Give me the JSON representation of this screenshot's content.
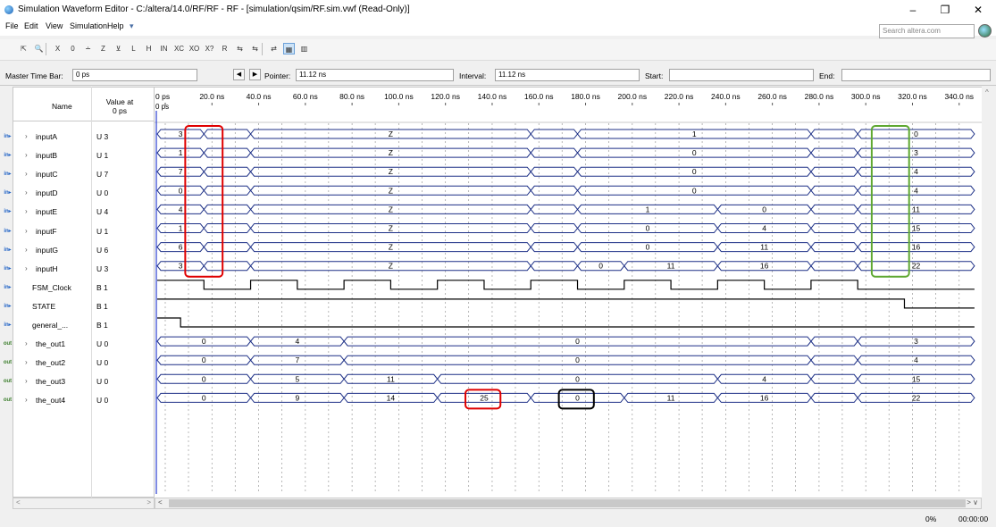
{
  "window": {
    "title": "Simulation Waveform Editor - C:/altera/14.0/RF/RF - RF - [simulation/qsim/RF.sim.vwf (Read-Only)]",
    "minimize": "–",
    "maximize": "❐",
    "close": "✕"
  },
  "menu": [
    "File",
    "Edit",
    "View",
    "Simulation",
    "Help"
  ],
  "search_placeholder": "Search altera.com",
  "toolbar_icons": [
    "pointer-icon",
    "zoom-icon",
    "invert-icon",
    "count-value-icon",
    "forcing-low-icon",
    "forcing-high-icon",
    "high-impedance-icon",
    "weak-low-icon",
    "weak-high-icon",
    "invert-value-icon",
    "count-icon",
    "clock-icon",
    "random-icon",
    "arbitrary-value-icon",
    "snap-icon",
    "merge-icon",
    "ungroup-icon",
    "grid-icon",
    "waveform-icon"
  ],
  "toolbar_glyphs": [
    "⇱",
    "🔍",
    "X",
    "0",
    "∸",
    "Z",
    "⊻",
    "L",
    "H",
    "IN",
    "XC",
    "XO",
    "X?",
    "R",
    "⇆",
    "⇆",
    "⇄",
    "▦",
    "▥"
  ],
  "masterbar": {
    "master_label": "Master Time Bar:",
    "master_value": "0 ps",
    "prev": "◀",
    "next": "▶",
    "pointer_label": "Pointer:",
    "pointer_value": "11.12 ns",
    "interval_label": "Interval:",
    "interval_value": "11.12 ns",
    "start_label": "Start:",
    "start_value": "",
    "end_label": "End:",
    "end_value": ""
  },
  "header": {
    "name": "Name",
    "value_at": "Value at",
    "value_at_time": "0 ps",
    "cursor_time": "0 ps"
  },
  "ticks": [
    "0 ps",
    "20.0 ns",
    "40.0 ns",
    "60.0 ns",
    "80.0 ns",
    "100.0 ns",
    "120.0 ns",
    "140.0 ns",
    "160.0 ns",
    "180.0 ns",
    "200.0 ns",
    "220.0 ns",
    "240.0 ns",
    "260.0 ns",
    "280.0 ns",
    "300.0 ns",
    "320.0 ns",
    "340.0 ns"
  ],
  "signals": [
    {
      "name": "inputA",
      "value": "U 3",
      "dir": "in",
      "expandable": true,
      "type": "bus",
      "segments": [
        [
          "3",
          0,
          20
        ],
        [
          "",
          20,
          40
        ],
        [
          "Z",
          40,
          160
        ],
        [
          "",
          160,
          180
        ],
        [
          "1",
          180,
          280
        ],
        [
          "",
          280,
          300
        ],
        [
          "0",
          300,
          350
        ]
      ]
    },
    {
      "name": "inputB",
      "value": "U 1",
      "dir": "in",
      "expandable": true,
      "type": "bus",
      "segments": [
        [
          "1",
          0,
          20
        ],
        [
          "",
          20,
          40
        ],
        [
          "Z",
          40,
          160
        ],
        [
          "",
          160,
          180
        ],
        [
          "0",
          180,
          280
        ],
        [
          "",
          280,
          300
        ],
        [
          "3",
          300,
          350
        ]
      ]
    },
    {
      "name": "inputC",
      "value": "U 7",
      "dir": "in",
      "expandable": true,
      "type": "bus",
      "segments": [
        [
          "7",
          0,
          20
        ],
        [
          "",
          20,
          40
        ],
        [
          "Z",
          40,
          160
        ],
        [
          "",
          160,
          180
        ],
        [
          "0",
          180,
          280
        ],
        [
          "",
          280,
          300
        ],
        [
          "4",
          300,
          350
        ]
      ]
    },
    {
      "name": "inputD",
      "value": "U 0",
      "dir": "in",
      "expandable": true,
      "type": "bus",
      "segments": [
        [
          "0",
          0,
          20
        ],
        [
          "",
          20,
          40
        ],
        [
          "Z",
          40,
          160
        ],
        [
          "",
          160,
          180
        ],
        [
          "0",
          180,
          280
        ],
        [
          "",
          280,
          300
        ],
        [
          "4",
          300,
          350
        ]
      ]
    },
    {
      "name": "inputE",
      "value": "U 4",
      "dir": "in",
      "expandable": true,
      "type": "bus",
      "segments": [
        [
          "4",
          0,
          20
        ],
        [
          "",
          20,
          40
        ],
        [
          "Z",
          40,
          160
        ],
        [
          "",
          160,
          180
        ],
        [
          "1",
          180,
          240
        ],
        [
          "0",
          240,
          280
        ],
        [
          "",
          280,
          300
        ],
        [
          "11",
          300,
          350
        ]
      ]
    },
    {
      "name": "inputF",
      "value": "U 1",
      "dir": "in",
      "expandable": true,
      "type": "bus",
      "segments": [
        [
          "1",
          0,
          20
        ],
        [
          "",
          20,
          40
        ],
        [
          "Z",
          40,
          160
        ],
        [
          "",
          160,
          180
        ],
        [
          "0",
          180,
          240
        ],
        [
          "4",
          240,
          280
        ],
        [
          "",
          280,
          300
        ],
        [
          "15",
          300,
          350
        ]
      ]
    },
    {
      "name": "inputG",
      "value": "U 6",
      "dir": "in",
      "expandable": true,
      "type": "bus",
      "segments": [
        [
          "6",
          0,
          20
        ],
        [
          "",
          20,
          40
        ],
        [
          "Z",
          40,
          160
        ],
        [
          "",
          160,
          180
        ],
        [
          "0",
          180,
          240
        ],
        [
          "11",
          240,
          280
        ],
        [
          "",
          280,
          300
        ],
        [
          "16",
          300,
          350
        ]
      ]
    },
    {
      "name": "inputH",
      "value": "U 3",
      "dir": "in",
      "expandable": true,
      "type": "bus",
      "segments": [
        [
          "3",
          0,
          20
        ],
        [
          "",
          20,
          40
        ],
        [
          "Z",
          40,
          160
        ],
        [
          "",
          160,
          180
        ],
        [
          "0",
          180,
          200
        ],
        [
          "11",
          200,
          240
        ],
        [
          "16",
          240,
          280
        ],
        [
          "",
          280,
          300
        ],
        [
          "22",
          300,
          350
        ]
      ]
    },
    {
      "name": "FSM_Clock",
      "value": "B 1",
      "dir": "in",
      "expandable": false,
      "type": "bit",
      "edges": [
        [
          0,
          1
        ],
        [
          20,
          0
        ],
        [
          40,
          1
        ],
        [
          60,
          0
        ],
        [
          80,
          1
        ],
        [
          100,
          0
        ],
        [
          120,
          1
        ],
        [
          140,
          0
        ],
        [
          160,
          1
        ],
        [
          180,
          0
        ],
        [
          200,
          1
        ],
        [
          220,
          0
        ],
        [
          240,
          1
        ],
        [
          260,
          0
        ],
        [
          280,
          1
        ],
        [
          300,
          0
        ],
        [
          350,
          0
        ]
      ]
    },
    {
      "name": "STATE",
      "value": "B 1",
      "dir": "in",
      "expandable": false,
      "type": "bit",
      "edges": [
        [
          0,
          1
        ],
        [
          320,
          0
        ],
        [
          350,
          0
        ]
      ]
    },
    {
      "name": "general_...",
      "value": "B 1",
      "dir": "in",
      "expandable": false,
      "type": "bit",
      "edges": [
        [
          0,
          1
        ],
        [
          10,
          0
        ],
        [
          350,
          0
        ]
      ]
    },
    {
      "name": "the_out1",
      "value": "U 0",
      "dir": "out",
      "expandable": true,
      "type": "bus",
      "segments": [
        [
          "0",
          0,
          40
        ],
        [
          "4",
          40,
          80
        ],
        [
          "0",
          80,
          280
        ],
        [
          "",
          280,
          300
        ],
        [
          "3",
          300,
          350
        ]
      ]
    },
    {
      "name": "the_out2",
      "value": "U 0",
      "dir": "out",
      "expandable": true,
      "type": "bus",
      "segments": [
        [
          "0",
          0,
          40
        ],
        [
          "7",
          40,
          80
        ],
        [
          "0",
          80,
          280
        ],
        [
          "",
          280,
          300
        ],
        [
          "4",
          300,
          350
        ]
      ]
    },
    {
      "name": "the_out3",
      "value": "U 0",
      "dir": "out",
      "expandable": true,
      "type": "bus",
      "segments": [
        [
          "0",
          0,
          40
        ],
        [
          "5",
          40,
          80
        ],
        [
          "11",
          80,
          120
        ],
        [
          "0",
          120,
          240
        ],
        [
          "4",
          240,
          280
        ],
        [
          "",
          280,
          300
        ],
        [
          "15",
          300,
          350
        ]
      ]
    },
    {
      "name": "the_out4",
      "value": "U 0",
      "dir": "out",
      "expandable": true,
      "type": "bus",
      "segments": [
        [
          "0",
          0,
          40
        ],
        [
          "9",
          40,
          80
        ],
        [
          "14",
          80,
          120
        ],
        [
          "25",
          120,
          160
        ],
        [
          "0",
          160,
          200
        ],
        [
          "11",
          200,
          240
        ],
        [
          "16",
          240,
          280
        ],
        [
          "",
          280,
          300
        ],
        [
          "22",
          300,
          350
        ]
      ]
    }
  ],
  "annotations": [
    {
      "color": "#e00000",
      "t0": 12,
      "t1": 28,
      "row0": 0,
      "row1": 7
    },
    {
      "color": "#5fa832",
      "t0": 306,
      "t1": 322,
      "row0": 0,
      "row1": 7
    },
    {
      "color": "#e00000",
      "t0": 132,
      "t1": 147,
      "row0": 14,
      "row1": 14
    },
    {
      "color": "#000000",
      "t0": 172,
      "t1": 187,
      "row0": 14,
      "row1": 14
    }
  ],
  "colors": {
    "bus_line": "#1c2f86",
    "bit_line": "#000000",
    "grid": "#9a9a9a",
    "cursor": "#2b3fd0"
  },
  "status": {
    "percent": "0%",
    "elapsed": "00:00:00"
  }
}
